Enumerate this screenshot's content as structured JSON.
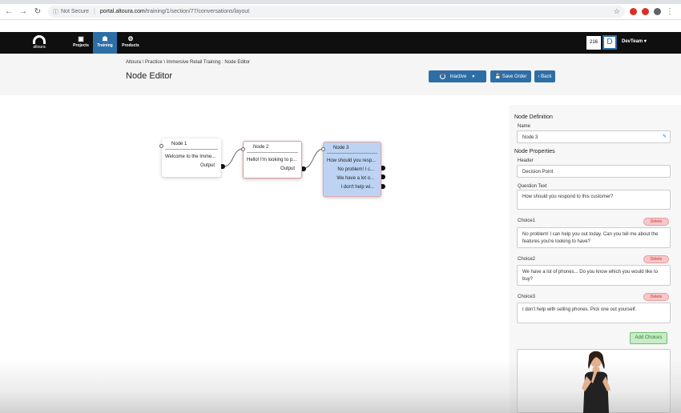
{
  "browser": {
    "security_label": "Not Secure",
    "url_host": "portal.altoura.com",
    "url_path": "/training/1/section/77/conversations/layout"
  },
  "header": {
    "logo_text": "altoura",
    "nav": [
      {
        "label": "Projects"
      },
      {
        "label": "Training"
      },
      {
        "label": "Products"
      }
    ],
    "counter": "216",
    "avatar_letter": "D",
    "user_label": "DevTeam"
  },
  "subheader": {
    "breadcrumb": "Altoura \\ Practice \\ Immersive Retail Training : Node Editor",
    "title": "Node Editor",
    "status_label": "Inactive",
    "save_label": "Save Order",
    "back_label": "Back"
  },
  "nodes": [
    {
      "title": "Node 1",
      "text": "Welcome to the Imme...",
      "output": "Output"
    },
    {
      "title": "Node 2",
      "text": "Hello! I'm looking to p...",
      "output": "Output"
    },
    {
      "title": "Node 3",
      "text": "How should you resp...",
      "choices": [
        "No problem! I c...",
        "We have a lot o...",
        "I don't help wi..."
      ]
    }
  ],
  "panel": {
    "definition_heading": "Node Definition",
    "name_label": "Name",
    "name_value": "Node 3",
    "properties_heading": "Node Properties",
    "header_label": "Header",
    "header_value": "Decision Point",
    "question_label": "Question Text",
    "question_value": "How should you respond to this customer?",
    "choices": [
      {
        "label": "Choice1",
        "value": "No problem! I can help you out today. Can you tell me about the features you're looking to have?"
      },
      {
        "label": "Choice2",
        "value": "We have a lot of phones... Do you know which you would like to buy?"
      },
      {
        "label": "Choice3",
        "value": "I don't help with selling phones. Pick one out yourself."
      }
    ],
    "delete_label": "Delete",
    "add_choices_label": "Add Choices"
  },
  "colors": {
    "primary": "#2e6ea6",
    "header_bg": "#0f0f0f",
    "node_selected": "#bcd3f3",
    "delete_bg": "#f8c7c9",
    "add_bg": "#c8ecc8"
  }
}
